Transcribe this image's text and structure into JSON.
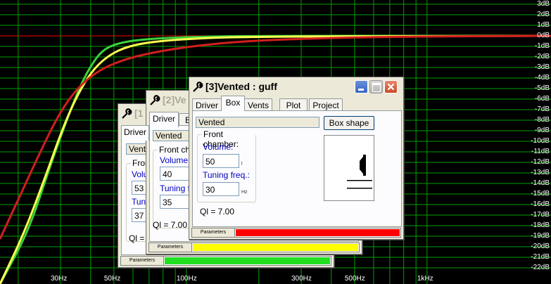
{
  "plot": {
    "y_labels": [
      "3dB",
      "2dB",
      "1dB",
      "0dB",
      "-1dB",
      "-2dB",
      "-3dB",
      "-4dB",
      "-5dB",
      "-6dB",
      "-7dB",
      "-8dB",
      "-9dB",
      "-10dB",
      "-11dB",
      "-12dB",
      "-13dB",
      "-14dB",
      "-15dB",
      "-16dB",
      "-17dB",
      "-18dB",
      "-19dB",
      "-20dB",
      "-21dB",
      "-22dB"
    ],
    "x_labels": [
      "30Hz",
      "50Hz",
      "100Hz",
      "300Hz",
      "500Hz",
      "1kHz"
    ],
    "grid_color": "#00a000",
    "zero_line_color": "#ff0000",
    "curve_colors": {
      "w1": "#3cd23c",
      "w2": "#ffff50",
      "w3": "#d21e1e"
    }
  },
  "window1": {
    "title": "[1",
    "tabs": [
      "Driver"
    ],
    "box_type": "Vented",
    "group_label": "Fron",
    "volume_label": "Volum",
    "volume_value": "53",
    "tuning_label": "Tunin",
    "tuning_value": "37",
    "ql_text": "Ql = 7",
    "status_label": "Parameters",
    "status_color": "#20e020"
  },
  "window2": {
    "title": "[2]Ve",
    "tabs": [
      "Driver",
      "B"
    ],
    "box_type": "Vented",
    "group_label": "Front cha",
    "volume_label": "Volume:",
    "volume_value": "40",
    "tuning_label": "Tuning fr",
    "tuning_value": "35",
    "ql_text": "Ql = 7.00",
    "status_label": "Parameters",
    "status_color": "#ffff00"
  },
  "window3": {
    "title": "[3]Vented : guff",
    "tabs": [
      "Driver",
      "Box",
      "Vents",
      "Plot",
      "Project"
    ],
    "box_type": "Vented",
    "box_shape_button": "Box shape",
    "group_label": "Front chamber:",
    "volume_label": "Volume:",
    "volume_value": "50",
    "volume_unit": "l",
    "tuning_label": "Tuning freq.:",
    "tuning_value": "30",
    "tuning_unit": "Hz",
    "ql_text": "Ql = 7.00",
    "status_label": "Parameters",
    "status_color": "#ff0000"
  }
}
